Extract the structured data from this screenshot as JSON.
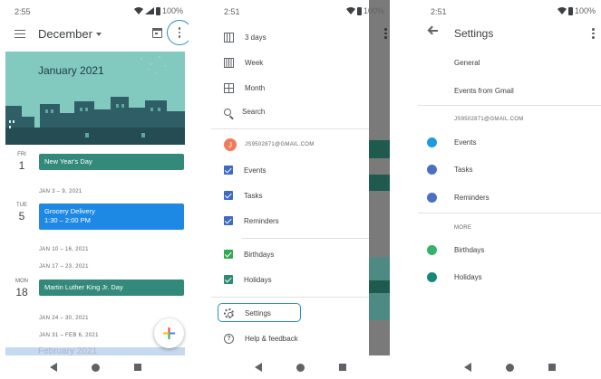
{
  "screen1": {
    "status_time": "2:55",
    "status_battery": "100%",
    "month_title": "December",
    "banner_title": "January 2021",
    "days": [
      {
        "dow": "FRI",
        "num": "1"
      },
      {
        "dow": "TUE",
        "num": "5"
      },
      {
        "dow": "MON",
        "num": "18"
      }
    ],
    "events": [
      {
        "title": "New Year's Day"
      },
      {
        "title": "Grocery Delivery",
        "time": "1:30 – 2:00 PM"
      },
      {
        "title": "Martin Luther King Jr. Day"
      }
    ],
    "week_labels": [
      "JAN 3 – 9, 2021",
      "JAN 10 – 16, 2021",
      "JAN 17 – 23, 2021",
      "JAN 24 – 30, 2021",
      "JAN 31 – FEB 6, 2021"
    ],
    "footer_peek": "February 2021",
    "icons": [
      "hamburger-menu-icon",
      "dropdown-arrow-icon",
      "today-calendar-icon",
      "more-vert-icon",
      "add-plus-icon"
    ]
  },
  "screen2": {
    "status_time": "2:51",
    "status_battery": "100%",
    "views": [
      {
        "label": "3 days",
        "icon": "three-days-icon"
      },
      {
        "label": "Week",
        "icon": "week-view-icon"
      },
      {
        "label": "Month",
        "icon": "month-view-icon"
      },
      {
        "label": "Search",
        "icon": "search-icon"
      }
    ],
    "account": {
      "initial": "J",
      "email": "JS9502871@GMAIL.COM"
    },
    "calendars": [
      {
        "label": "Events",
        "color": "#3f6ac1"
      },
      {
        "label": "Tasks",
        "color": "#3f6ac1"
      },
      {
        "label": "Reminders",
        "color": "#3f6ac1"
      }
    ],
    "other_calendars": [
      {
        "label": "Birthdays",
        "color": "#34a853"
      },
      {
        "label": "Holidays",
        "color": "#2e8b73"
      }
    ],
    "settings_label": "Settings",
    "help_label": "Help & feedback"
  },
  "screen3": {
    "status_time": "2:51",
    "status_battery": "100%",
    "title": "Settings",
    "general": "General",
    "events_from_gmail": "Events from Gmail",
    "account_header": "JS9502871@GMAIL.COM",
    "account_items": [
      {
        "label": "Events",
        "color": "#1e9be0"
      },
      {
        "label": "Tasks",
        "color": "#4c6fc5"
      },
      {
        "label": "Reminders",
        "color": "#4c6fc5"
      }
    ],
    "more_header": "MORE",
    "more_items": [
      {
        "label": "Birthdays",
        "color": "#34b36b"
      },
      {
        "label": "Holidays",
        "color": "#16887a"
      }
    ]
  },
  "colors": {
    "accent_highlight": "#2a8bc7",
    "event_green": "#33897a",
    "event_blue": "#1e88e5"
  }
}
